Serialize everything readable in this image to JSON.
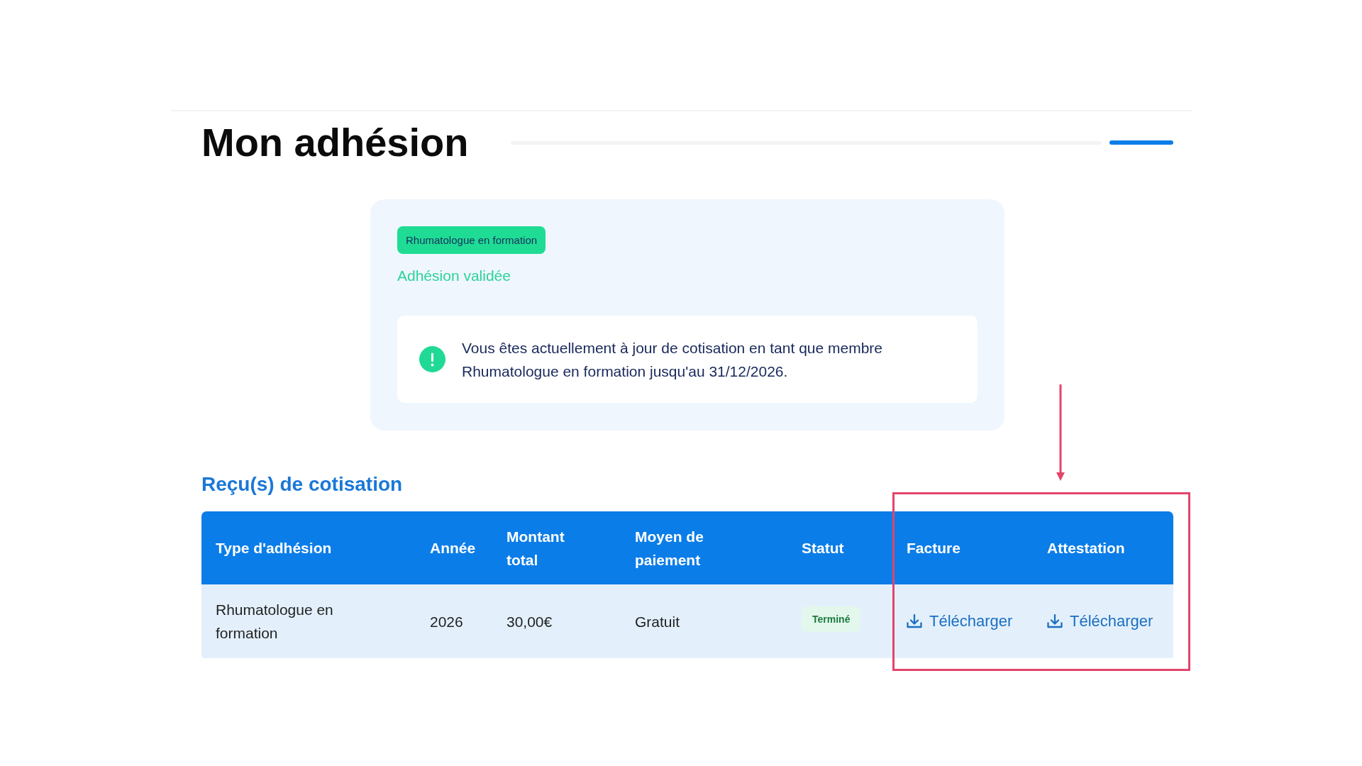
{
  "page": {
    "title": "Mon adhésion"
  },
  "membership_card": {
    "badge": "Rhumatologue en formation",
    "status": "Adhésion validée",
    "notice": {
      "kind": "success",
      "text": "Vous êtes actuellement à jour de cotisation en tant que membre Rhumatologue en formation jusqu'au 31/12/2026."
    }
  },
  "receipts": {
    "title": "Reçu(s) de cotisation",
    "columns": [
      "Type d'adhésion",
      "Année",
      "Montant total",
      "Moyen de paiement",
      "Statut",
      "Facture",
      "Attestation"
    ],
    "rows": [
      {
        "cells": [
          {
            "kind": "text",
            "text": "Rhumatologue en formation"
          },
          {
            "kind": "text",
            "text": "2026"
          },
          {
            "kind": "text",
            "text": "30,00€"
          },
          {
            "kind": "text",
            "text": "Gratuit"
          },
          {
            "kind": "status",
            "text": "Terminé"
          },
          {
            "kind": "download",
            "text": "Télécharger"
          },
          {
            "kind": "download",
            "text": "Télécharger"
          }
        ]
      }
    ]
  }
}
